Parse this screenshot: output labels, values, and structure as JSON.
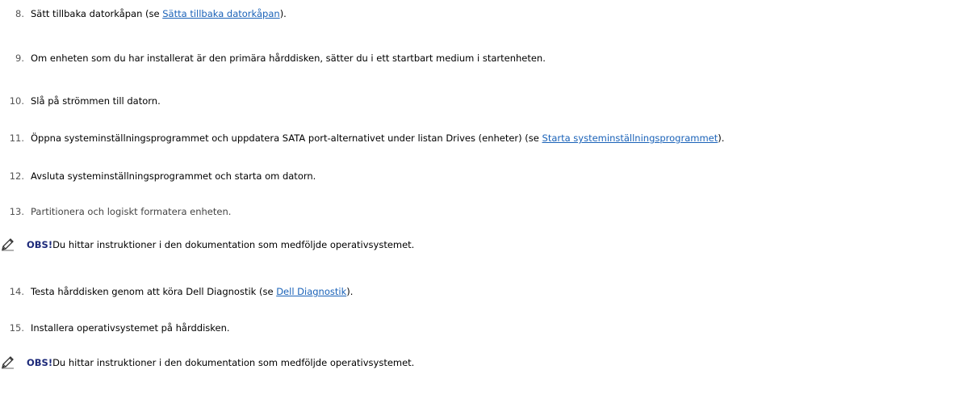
{
  "steps": [
    {
      "number": "8.",
      "before": "Sätt tillbaka datorkåpan (se ",
      "link": "Sätta tillbaka datorkåpan",
      "after": ")."
    },
    {
      "number": "9.",
      "text": "Om enheten som du har installerat är den primära hårddisken, sätter du i ett startbart medium i startenheten."
    },
    {
      "number": "10.",
      "text": "Slå på strömmen till datorn."
    },
    {
      "number": "11.",
      "before": "Öppna systeminställningsprogrammet och uppdatera SATA port",
      "middle": "-alternativet under listan Drives (enheter) (se ",
      "link": "Starta systeminställningsprogrammet",
      "after": ")."
    },
    {
      "number": "12.",
      "text": "Avsluta systeminställningsprogrammet och starta om datorn."
    },
    {
      "number": "13.",
      "text": "Partitionera och logiskt formatera enheten."
    },
    {
      "number": "14.",
      "before": "Testa hårddisken genom att köra Dell Diagnostik (se ",
      "link": "Dell Diagnostik",
      "after": ")."
    },
    {
      "number": "15.",
      "text": "Installera operativsystemet på hårddisken."
    }
  ],
  "notes": [
    {
      "label": "OBS!",
      "text": " Du hittar instruktioner i den dokumentation som medföljde operativsystemet."
    },
    {
      "label": "OBS!",
      "text": " Du hittar instruktioner i den dokumentation som medföljde operativsystemet."
    }
  ],
  "icons": {
    "note": "pencil-note-icon"
  },
  "colors": {
    "link": "#1a62b8",
    "note_label": "#1d2a7a"
  }
}
